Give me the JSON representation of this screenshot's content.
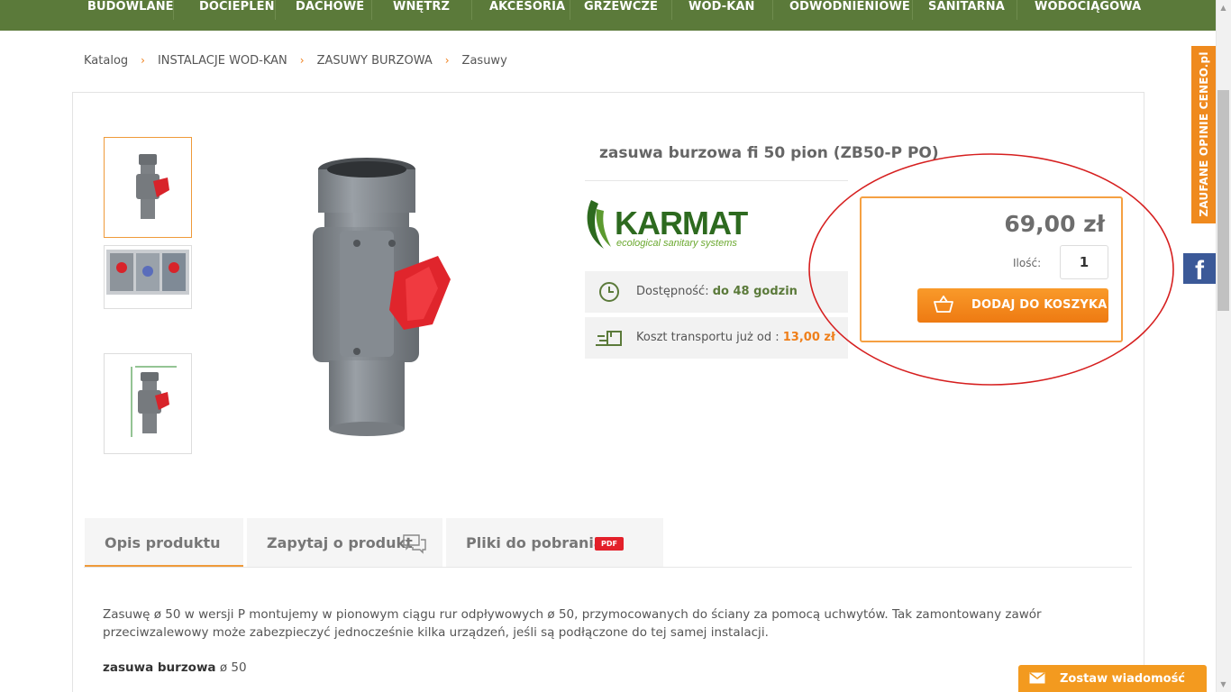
{
  "nav": {
    "items": [
      "BUDOWLANE",
      "DOCIEPLEŃ",
      "DACHOWE",
      "WNĘTRZ",
      "AKCESORIA",
      "GRZEWCZE",
      "WOD-KAN",
      "ODWODNIENIOWE",
      "SANITARNA",
      "WODOCIĄGOWA"
    ]
  },
  "breadcrumb": [
    "Katalog",
    "INSTALACJE WOD-KAN",
    "ZASUWY BURZOWA",
    "Zasuwy"
  ],
  "product": {
    "title": "zasuwa burzowa fi 50 pion (ZB50-P PO)",
    "brand_logo_text": "KARMAT",
    "brand_tagline": "ecological sanitary systems",
    "availability_label": "Dostępność:",
    "availability_value": "do 48 godzin",
    "shipping_label": "Koszt transportu już od :",
    "shipping_value": "13,00 zł",
    "price": "69,00 zł",
    "qty_label": "Ilość:",
    "qty_value": "1",
    "add_to_cart": "DODAJ DO KOSZYKA"
  },
  "tabs": [
    {
      "label": "Opis produktu"
    },
    {
      "label": "Zapytaj o produkt"
    },
    {
      "label": "Pliki do pobrania",
      "badge": "PDF"
    }
  ],
  "description": {
    "text": "Zasuwę ø 50 w wersji P montujemy w pionowym ciągu rur odpływowych ø 50, przymocowanych do ściany za pomocą uchwytów. Tak zamontowany zawór przeciwzalewowy może zabezpieczyć jednocześnie kilka urządzeń, jeśli są podłączone do tej samej instalacji.",
    "name_bold": "zasuwa burzowa",
    "name_rest": "ø 50"
  },
  "widgets": {
    "ceneo": "ZAUFANE OPINIE CENEO.pl",
    "facebook": "f",
    "chat": "Zostaw wiadomość"
  },
  "colors": {
    "nav_green": "#5b7a3a",
    "accent_orange": "#ef7f1a",
    "facebook_blue": "#3b5998",
    "annotation_red": "#d61f1f"
  }
}
